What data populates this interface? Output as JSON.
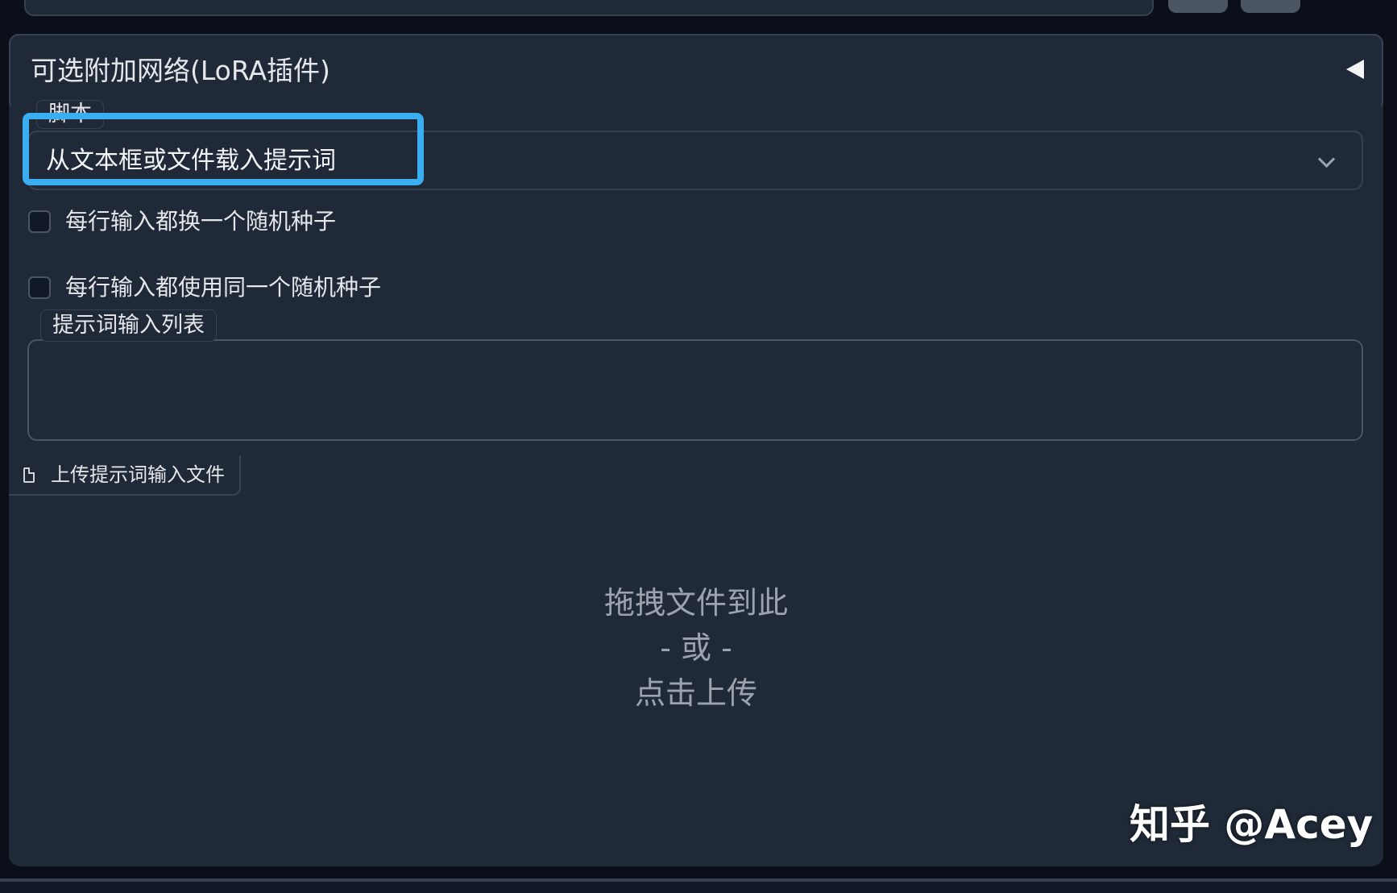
{
  "accordion": {
    "title": "可选附加网络(LoRA插件)"
  },
  "script": {
    "label": "脚本",
    "selected": "从文本框或文件载入提示词"
  },
  "checkboxes": [
    {
      "label": "每行输入都换一个随机种子",
      "checked": false
    },
    {
      "label": "每行输入都使用同一个随机种子",
      "checked": false
    }
  ],
  "prompt_list": {
    "label": "提示词输入列表",
    "value": ""
  },
  "upload": {
    "tab_label": "上传提示词输入文件",
    "drop_line1": "拖拽文件到此",
    "drop_line2": "- 或 -",
    "drop_line3": "点击上传"
  },
  "watermark": {
    "text": "知乎 @Acey"
  },
  "colors": {
    "background": "#1f2937",
    "highlight": "#3aaef0",
    "text": "#e5e7eb",
    "muted_text": "#9ca3af"
  }
}
